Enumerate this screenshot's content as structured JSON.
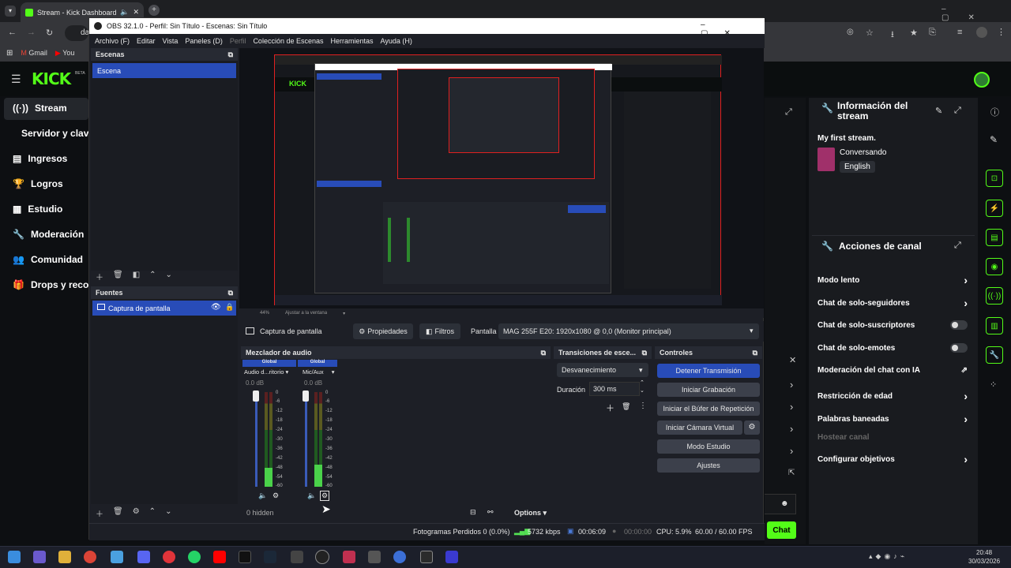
{
  "browser": {
    "tab_title": "Stream - Kick Dashboard",
    "url_fragment": "da",
    "bookmarks": [
      "Gmail",
      "You"
    ]
  },
  "kick": {
    "logo": "KICK",
    "logo_badge": "BETA",
    "nav": [
      "Stream",
      "Servidor y clave d",
      "Ingresos",
      "Logros",
      "Estudio",
      "Moderación",
      "Comunidad",
      "Drops y recom"
    ],
    "info_panel": {
      "title": "Información del stream",
      "stream_title": "My first stream.",
      "category": "Conversando",
      "language": "English"
    },
    "actions_panel": {
      "title": "Acciones de canal",
      "items": [
        "Modo lento",
        "Chat de solo-seguidores",
        "Chat de solo-suscriptores",
        "Chat de solo-emotes",
        "Moderación del chat con IA",
        "Restricción de edad",
        "Palabras baneadas",
        "Hostear canal",
        "Configurar objetivos"
      ]
    },
    "chat_button": "Chat"
  },
  "obs": {
    "window_title": "OBS 32.1.0 - Perfil: Sin Título - Escenas: Sin Título",
    "menu": [
      "Archivo (F)",
      "Editar",
      "Vista",
      "Paneles (D)",
      "Perfil",
      "Colección de Escenas",
      "Herramientas",
      "Ayuda (H)"
    ],
    "scenes": {
      "title": "Escenas",
      "items": [
        "Escena"
      ]
    },
    "sources": {
      "title": "Fuentes",
      "items": [
        "Captura de pantalla"
      ]
    },
    "preview": {
      "zoom": "44%",
      "fit_label": "Ajustar a la ventana"
    },
    "source_bar": {
      "name": "Captura de pantalla",
      "properties": "Propiedades",
      "filters": "Filtros",
      "display_label": "Pantalla",
      "display_value": "MAG 255F E20: 1920x1080 @ 0,0 (Monitor principal)"
    },
    "mixer": {
      "title": "Mezclador de audio",
      "channels": [
        {
          "tag": "Global",
          "name": "Audio d...ritorio",
          "db": "0.0 dB"
        },
        {
          "tag": "Global",
          "name": "Mic/Aux",
          "db": "0.0 dB"
        }
      ],
      "scale": [
        "0",
        "-6",
        "-12",
        "-18",
        "-24",
        "-30",
        "-36",
        "-42",
        "-48",
        "-54",
        "-60"
      ],
      "hidden": "0 hidden",
      "options": "Options"
    },
    "transitions": {
      "title": "Transiciones de esce...",
      "type": "Desvanecimiento",
      "duration_label": "Duración",
      "duration_value": "300 ms"
    },
    "controls": {
      "title": "Controles",
      "buttons": [
        "Detener Transmisión",
        "Iniciar Grabación",
        "Iniciar el Búfer de Repetición",
        "Iniciar Cámara Virtual",
        "Modo Estudio",
        "Ajustes"
      ]
    },
    "status": {
      "dropped": "Fotogramas Perdidos 0 (0.0%)",
      "bitrate": "5732 kbps",
      "stream_time": "00:06:09",
      "rec_time": "00:00:00",
      "cpu": "CPU: 5.9%",
      "fps": "60.00 / 60.00 FPS"
    }
  },
  "taskbar": {
    "time": "20:48",
    "date": "30/03/2026"
  },
  "colors": {
    "kick_green": "#53fc18",
    "obs_select": "#284cb8",
    "obs_bg": "#1d1f26",
    "live_red": "#e02020"
  }
}
